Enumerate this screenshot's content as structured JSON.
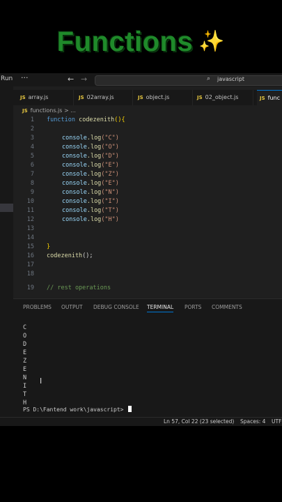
{
  "overlay": {
    "title": "Functions",
    "sparkle": "✨"
  },
  "menubar": {
    "run": "Run",
    "more": "···",
    "back": "←",
    "forward": "→",
    "search_icon": "⌕",
    "search_text": "javascript"
  },
  "tabs": [
    {
      "icon": "JS",
      "label": "array.js"
    },
    {
      "icon": "JS",
      "label": "02array.js"
    },
    {
      "icon": "JS",
      "label": "object.js"
    },
    {
      "icon": "JS",
      "label": "02_object.js"
    },
    {
      "icon": "JS",
      "label": "func"
    }
  ],
  "breadcrumb": {
    "icon": "JS",
    "file": "functions.js",
    "sep": " > ..."
  },
  "code": {
    "line_numbers": [
      "1",
      "2",
      "3",
      "4",
      "5",
      "6",
      "7",
      "8",
      "9",
      "10",
      "11",
      "12",
      "13",
      "14",
      "15",
      "16",
      "17",
      "18",
      "19"
    ],
    "fn_kw": "function",
    "fn_name": "codezenith",
    "fn_tail": "(){",
    "log_obj": "console",
    "log_fn": ".log",
    "strings": [
      "(\"C\")",
      "(\"O\")",
      "(\"D\")",
      "(\"E\")",
      "(\"Z\")",
      "(\"E\")",
      "(\"N\")",
      "(\"I\")",
      "(\"T\")",
      "(\"H\")"
    ],
    "close": "}",
    "call_name": "codezenith",
    "call_tail": "();",
    "comment": "// rest operations"
  },
  "panel": {
    "tabs": [
      "PROBLEMS",
      "OUTPUT",
      "DEBUG CONSOLE",
      "TERMINAL",
      "PORTS",
      "COMMENTS"
    ],
    "active_tab": "TERMINAL",
    "output": [
      "C",
      "O",
      "D",
      "E",
      "Z",
      "E",
      "N",
      "I",
      "T",
      "H"
    ],
    "prompt": "PS D:\\Fantend work\\javascript>"
  },
  "status": {
    "position": "Ln 57, Col 22 (23 selected)",
    "spaces": "Spaces: 4",
    "encoding": "UTF"
  }
}
